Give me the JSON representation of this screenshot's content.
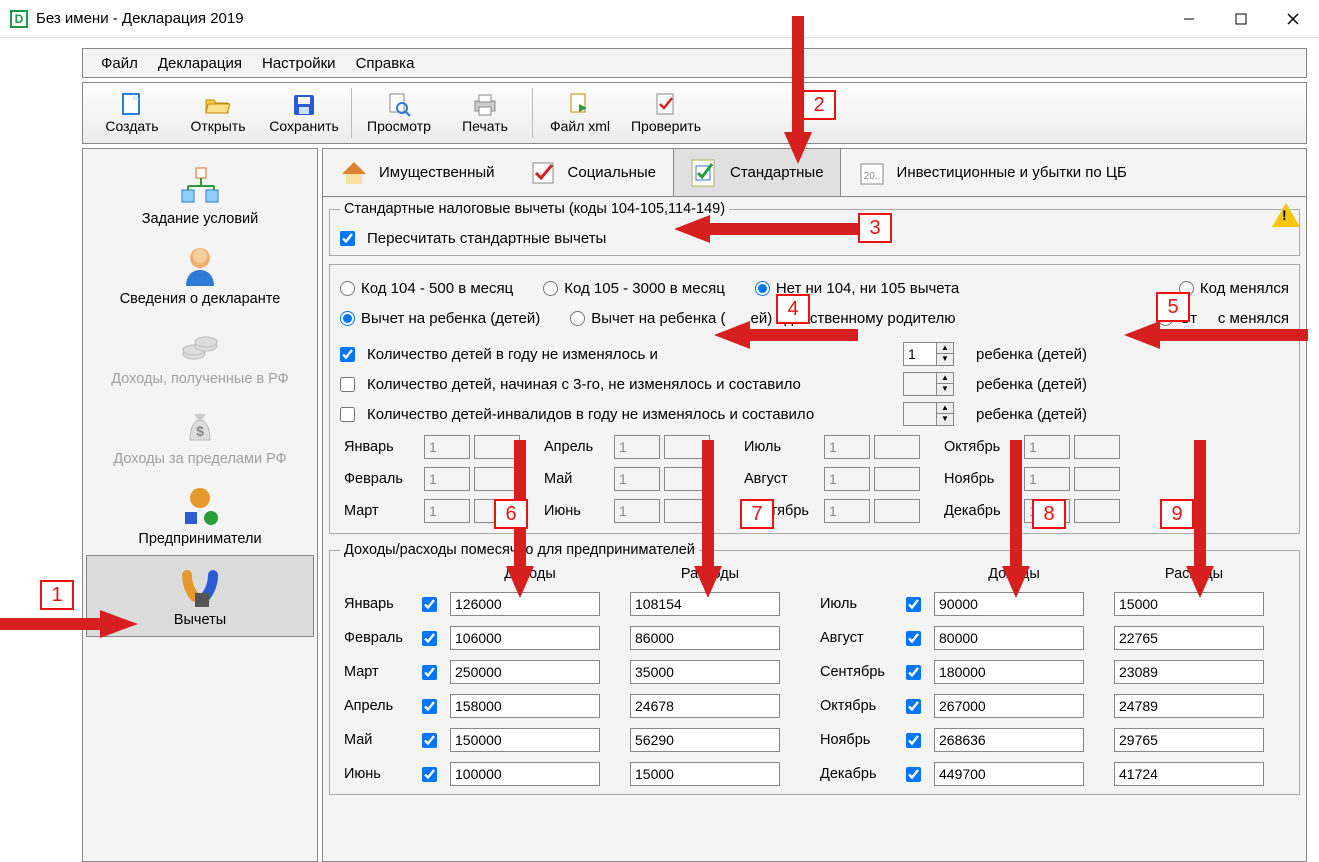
{
  "window": {
    "title": "Без имени - Декларация 2019"
  },
  "menu": {
    "file": "Файл",
    "decl": "Декларация",
    "settings": "Настройки",
    "help": "Справка"
  },
  "toolbar": {
    "new": "Создать",
    "open": "Открыть",
    "save": "Сохранить",
    "preview": "Просмотр",
    "print": "Печать",
    "xml": "Файл xml",
    "check": "Проверить"
  },
  "sidebar": {
    "cond": "Задание условий",
    "declarant": "Сведения о декларанте",
    "income_rf": "Доходы, полученные в РФ",
    "income_out": "Доходы за пределами РФ",
    "entrepreneur": "Предприниматели",
    "deductions": "Вычеты"
  },
  "tabs": {
    "prop": "Имущественный",
    "social": "Социальные",
    "standard": "Стандартные",
    "invest": "Инвестиционные и убытки по ЦБ"
  },
  "group": {
    "legend": "Стандартные налоговые вычеты (коды 104-105,114-149)",
    "recalc": "Пересчитать стандартные вычеты",
    "code104": "Код 104 - 500 в месяц",
    "code105": "Код 105 - 3000 в месяц",
    "none104105": "Нет ни 104, ни 105 вычета",
    "code_changed": "Код менялся",
    "child": "Вычет на ребенка (детей)",
    "child_single_pref": "Вычет на ребенка (",
    "child_single_mid": "ей) единственному родителю",
    "status_changed_pref": "Ст",
    "status_changed_suf": "с менялся",
    "count_child_pref": "Количество детей в году не изменялось и",
    "count_child3": "Количество детей, начиная с 3-го, не изменялось и составило",
    "count_child_inv": "Количество детей-инвалидов в году не изменялось и составило",
    "children_lbl": "ребенка (детей)",
    "children_value": "1"
  },
  "months": {
    "jan": "Январь",
    "feb": "Февраль",
    "mar": "Март",
    "apr": "Апрель",
    "may": "Май",
    "jun": "Июнь",
    "jul": "Июль",
    "aug": "Август",
    "sep": "Сентябрь",
    "oct": "Октябрь",
    "nov": "Ноябрь",
    "dec": "Декабрь",
    "v": "1"
  },
  "ie": {
    "legend": "Доходы/расходы помесячно для предпринимателей",
    "inc_h": "Доходы",
    "exp_h": "Расходы",
    "rows_left": [
      {
        "m": "Январь",
        "inc": "126000",
        "exp": "108154"
      },
      {
        "m": "Февраль",
        "inc": "106000",
        "exp": "86000"
      },
      {
        "m": "Март",
        "inc": "250000",
        "exp": "35000"
      },
      {
        "m": "Апрель",
        "inc": "158000",
        "exp": "24678"
      },
      {
        "m": "Май",
        "inc": "150000",
        "exp": "56290"
      },
      {
        "m": "Июнь",
        "inc": "100000",
        "exp": "15000"
      }
    ],
    "rows_right": [
      {
        "m": "Июль",
        "inc": "90000",
        "exp": "15000"
      },
      {
        "m": "Август",
        "inc": "80000",
        "exp": "22765"
      },
      {
        "m": "Сентябрь",
        "inc": "180000",
        "exp": "23089"
      },
      {
        "m": "Октябрь",
        "inc": "267000",
        "exp": "24789"
      },
      {
        "m": "Ноябрь",
        "inc": "268636",
        "exp": "29765"
      },
      {
        "m": "Декабрь",
        "inc": "449700",
        "exp": "41724"
      }
    ]
  },
  "annotations": {
    "1": "1",
    "2": "2",
    "3": "3",
    "4": "4",
    "5": "5",
    "6": "6",
    "7": "7",
    "8": "8",
    "9": "9"
  }
}
